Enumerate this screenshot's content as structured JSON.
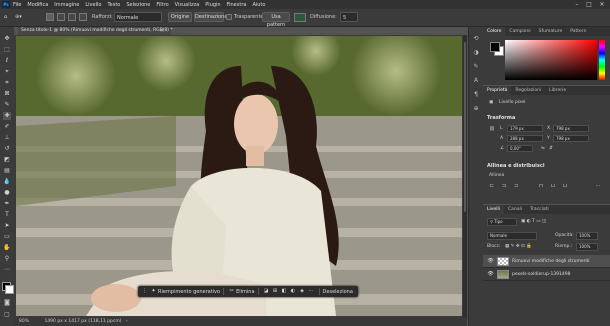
{
  "app": {
    "logo": "Ps"
  },
  "menu": [
    "File",
    "Modifica",
    "Immagine",
    "Livello",
    "Testo",
    "Selezione",
    "Filtro",
    "Visualizza",
    "Plugin",
    "Finestra",
    "Aiuto"
  ],
  "options_bar": {
    "feather_label": "Rafforzi:",
    "style_value": "Normale",
    "origin_button": "Origine",
    "destination_button": "Destinazione",
    "transparent_label": "Trasparente",
    "use_pattern_button": "Usa pattern",
    "diffusion_label": "Diffusione:",
    "diffusion_value": "5"
  },
  "document": {
    "tab_title": "Senza titolo-1 @ 80% (Rimuovi modifiche degli strumenti, RGB/8) *",
    "zoom": "80%",
    "doc_info": "1490 px x 1417 px (118,11 ppcm)"
  },
  "context_bar": {
    "generative_fill": "Riempimento generativo",
    "delete": "Elimina",
    "deselect": "Deseleziona"
  },
  "color_panel": {
    "tabs": [
      "Colore",
      "Campioni",
      "Sfumature",
      "Pattern"
    ],
    "foreground": "#000000",
    "background": "#ffffff",
    "hue_color": "#ff0000"
  },
  "properties_panel": {
    "tabs": [
      "Proprietà",
      "Regolazioni",
      "Librerie"
    ],
    "layer_type": "Livello pixel",
    "transform_title": "Trasforma",
    "w": "179 px",
    "h": "288 px",
    "x": "798 px",
    "y": "798 px",
    "angle": "0,00°",
    "align_title": "Allinea e distribuisci",
    "align_label": "Allinea"
  },
  "layers_panel": {
    "tabs": [
      "Livelli",
      "Canali",
      "Tracciati"
    ],
    "kind_filter": "Tipo",
    "blend_mode": "Normale",
    "opacity_label": "Opacità:",
    "opacity_value": "100%",
    "lock_label": "Blocc:",
    "fill_label": "Riemp.:",
    "fill_value": "100%",
    "layers": [
      {
        "name": "Rimuovi modifiche degli strumenti",
        "selected": true
      },
      {
        "name": "pexels-soldierup-1391498",
        "selected": false
      }
    ]
  }
}
